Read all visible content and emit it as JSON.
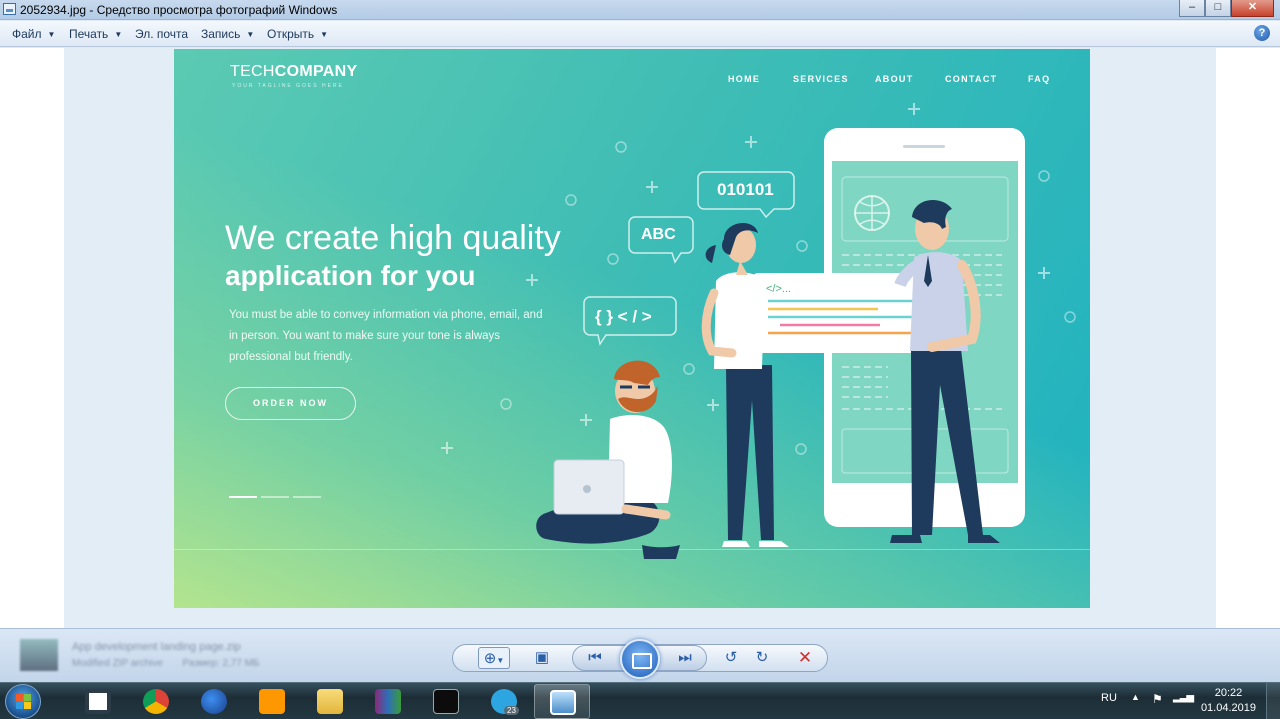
{
  "window": {
    "title": "2052934.jpg - Средство просмотра фотографий Windows",
    "controls": [
      "minimize",
      "maximize",
      "close"
    ]
  },
  "menu": {
    "items": [
      {
        "label": "Файл",
        "has_dropdown": true
      },
      {
        "label": "Печать",
        "has_dropdown": true
      },
      {
        "label": "Эл. почта",
        "has_dropdown": false
      },
      {
        "label": "Запись",
        "has_dropdown": true
      },
      {
        "label": "Открыть",
        "has_dropdown": true
      }
    ],
    "help_icon": "help-icon",
    "help_glyph": "?"
  },
  "photo": {
    "logo_light": "TECH",
    "logo_bold": "COMPANY",
    "tagline": "YOUR TAGLINE GOES HERE",
    "nav": [
      "HOME",
      "SERVICES",
      "ABOUT",
      "CONTACT",
      "FAQ"
    ],
    "headline_light": "We create high quality",
    "headline_bold": "application for you",
    "paragraph": "You must be able to convey information via phone, email, and in person. You want to make sure your tone is always professional but friendly.",
    "cta": "ORDER NOW",
    "bubbles": {
      "binary": "010101",
      "abc": "ABC",
      "code": "{ } < / >",
      "card_tag": "</>..."
    },
    "slides_total": 3,
    "slide_active": 1
  },
  "controlbar": {
    "file_name": "App development landing page.zip",
    "file_meta": "Modified ZIP archive",
    "file_size_label": "Размер: 2,77 МБ",
    "controls": [
      "zoom-icon",
      "fit-window-icon",
      "previous-icon",
      "slideshow-icon",
      "next-icon",
      "rotate-left-icon",
      "rotate-right-icon",
      "delete-icon"
    ]
  },
  "taskbar": {
    "apps": [
      "box-app",
      "chrome",
      "firefox",
      "sublime-text",
      "file-explorer",
      "winrar",
      "command-prompt",
      "telegram",
      "photo-viewer"
    ],
    "active_app": "photo-viewer",
    "telegram_badge": "23",
    "language": "RU",
    "time": "20:22",
    "date": "01.04.2019"
  },
  "colors": {
    "photo_teal": "#1fb2c0",
    "photo_green": "#b9e68c",
    "shirt_white": "#ffffff",
    "pants_navy": "#1e3a5c",
    "beard_orange": "#c0642c"
  }
}
